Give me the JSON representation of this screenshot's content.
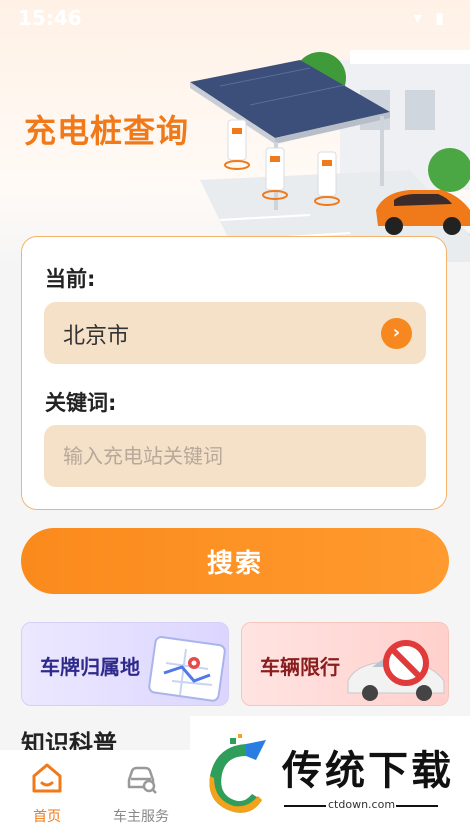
{
  "status_bar": {
    "time": "15:46",
    "icons": "▾ ▮"
  },
  "hero": {
    "title": "充电桩查询"
  },
  "search_card": {
    "current_label": "当前:",
    "city_value": "北京市",
    "keyword_label": "关键词:",
    "keyword_placeholder": "输入充电站关键词",
    "keyword_value": ""
  },
  "search_button": {
    "label": "搜索"
  },
  "features": [
    {
      "label": "车牌归属地",
      "icon": "map-icon"
    },
    {
      "label": "车辆限行",
      "icon": "no-car-icon"
    }
  ],
  "knowledge": {
    "title": "知识科普"
  },
  "tabs": [
    {
      "label": "首页",
      "icon": "home-icon",
      "active": true
    },
    {
      "label": "车主服务",
      "icon": "car-service-icon",
      "active": false
    }
  ],
  "watermark": {
    "title": "传统下载",
    "domain": "ctdown.com"
  },
  "colors": {
    "accent": "#f7881f",
    "input_bg": "#f5e0c8",
    "page_bg": "#f5f5f5"
  }
}
